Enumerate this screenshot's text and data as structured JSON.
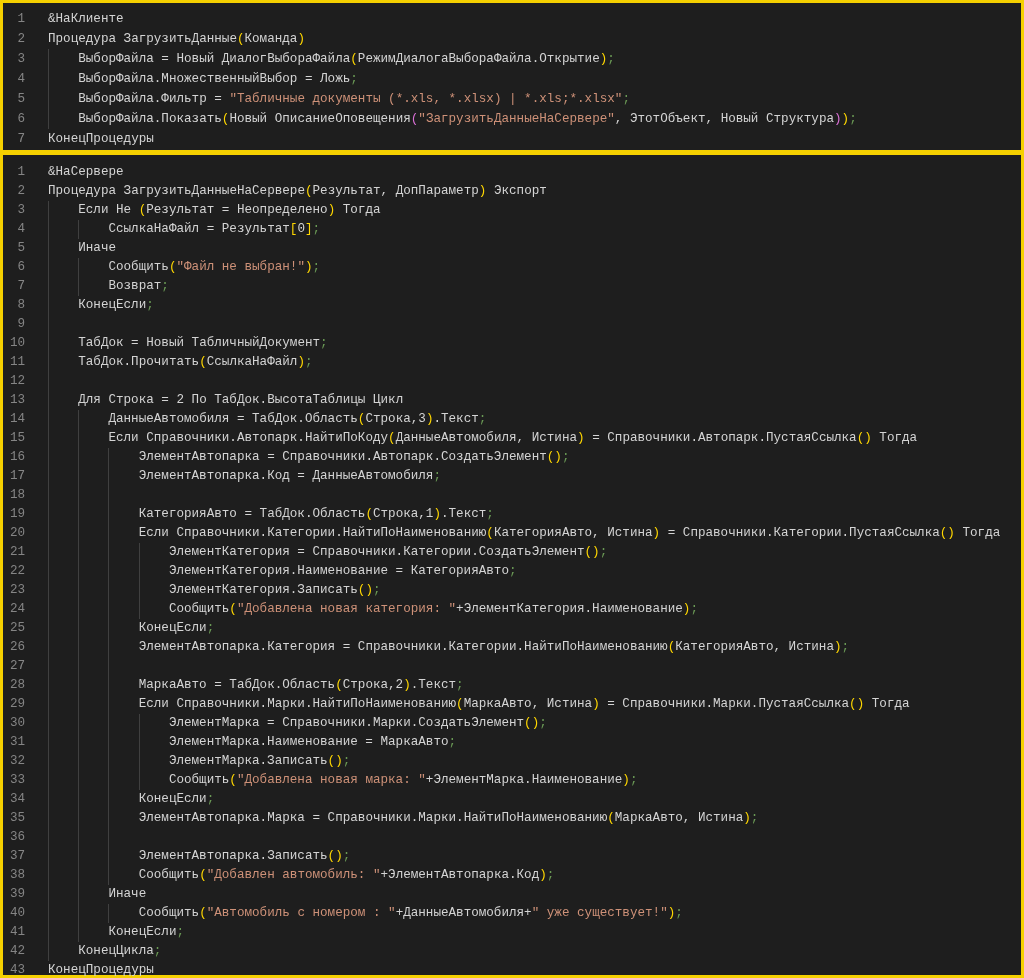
{
  "panels": [
    {
      "lines": [
        {
          "number": "1",
          "code": "&НаКлиенте"
        },
        {
          "number": "2",
          "code": "Процедура ЗагрузитьДанные(Команда)"
        },
        {
          "number": "3",
          "code": "    ВыборФайла = Новый ДиалогВыбораФайла(РежимДиалогаВыбораФайла.Открытие);"
        },
        {
          "number": "4",
          "code": "    ВыборФайла.МножественныйВыбор = Ложь;"
        },
        {
          "number": "5",
          "code": "    ВыборФайла.Фильтр = \"Табличные документы (*.xls, *.xlsx) | *.xls;*.xlsx\";"
        },
        {
          "number": "6",
          "code": "    ВыборФайла.Показать(Новый ОписаниеОповещения(\"ЗагрузитьДанныеНаСервере\", ЭтотОбъект, Новый Структура));"
        },
        {
          "number": "7",
          "code": "КонецПроцедуры"
        }
      ]
    },
    {
      "lines": [
        {
          "number": "1",
          "code": "&НаСервере"
        },
        {
          "number": "2",
          "code": "Процедура ЗагрузитьДанныеНаСервере(Результат, ДопПараметр) Экспорт"
        },
        {
          "number": "3",
          "code": "    Если Не (Результат = Неопределено) Тогда"
        },
        {
          "number": "4",
          "code": "        СсылкаНаФайл = Результат[0];"
        },
        {
          "number": "5",
          "code": "    Иначе"
        },
        {
          "number": "6",
          "code": "        Сообщить(\"Файл не выбран!\");"
        },
        {
          "number": "7",
          "code": "        Возврат;"
        },
        {
          "number": "8",
          "code": "    КонецЕсли;"
        },
        {
          "number": "9"
        },
        {
          "number": "10",
          "code": "    ТабДок = Новый ТабличныйДокумент;"
        },
        {
          "number": "11",
          "code": "    ТабДок.Прочитать(СсылкаНаФайл);"
        },
        {
          "number": "12"
        },
        {
          "number": "13",
          "code": "    Для Строка = 2 По ТабДок.ВысотаТаблицы Цикл"
        },
        {
          "number": "14",
          "code": "        ДанныеАвтомобиля = ТабДок.Область(Строка,3).Текст;"
        },
        {
          "number": "15",
          "code": "        Если Справочники.Автопарк.НайтиПоКоду(ДанныеАвтомобиля, Истина) = Справочники.Автопарк.ПустаяСсылка() Тогда"
        },
        {
          "number": "16",
          "code": "            ЭлементАвтопарка = Справочники.Автопарк.СоздатьЭлемент();"
        },
        {
          "number": "17",
          "code": "            ЭлементАвтопарка.Код = ДанныеАвтомобиля;"
        },
        {
          "number": "18"
        },
        {
          "number": "19",
          "code": "            КатегорияАвто = ТабДок.Область(Строка,1).Текст;"
        },
        {
          "number": "20",
          "code": "            Если Справочники.Категории.НайтиПоНаименованию(КатегорияАвто, Истина) = Справочники.Категории.ПустаяСсылка() Тогда"
        },
        {
          "number": "21",
          "code": "                ЭлементКатегория = Справочники.Категории.СоздатьЭлемент();"
        },
        {
          "number": "22",
          "code": "                ЭлементКатегория.Наименование = КатегорияАвто;"
        },
        {
          "number": "23",
          "code": "                ЭлементКатегория.Записать();"
        },
        {
          "number": "24",
          "code": "                Сообщить(\"Добавлена новая категория: \"+ЭлементКатегория.Наименование);"
        },
        {
          "number": "25",
          "code": "            КонецЕсли;"
        },
        {
          "number": "26",
          "code": "            ЭлементАвтопарка.Категория = Справочники.Категории.НайтиПоНаименованию(КатегорияАвто, Истина);"
        },
        {
          "number": "27"
        },
        {
          "number": "28",
          "code": "            МаркаАвто = ТабДок.Область(Строка,2).Текст;"
        },
        {
          "number": "29",
          "code": "            Если Справочники.Марки.НайтиПоНаименованию(МаркаАвто, Истина) = Справочники.Марки.ПустаяСсылка() Тогда"
        },
        {
          "number": "30",
          "code": "                ЭлементМарка = Справочники.Марки.СоздатьЭлемент();"
        },
        {
          "number": "31",
          "code": "                ЭлементМарка.Наименование = МаркаАвто;"
        },
        {
          "number": "32",
          "code": "                ЭлементМарка.Записать();"
        },
        {
          "number": "33",
          "code": "                Сообщить(\"Добавлена новая марка: \"+ЭлементМарка.Наименование);"
        },
        {
          "number": "34",
          "code": "            КонецЕсли;"
        },
        {
          "number": "35",
          "code": "            ЭлементАвтопарка.Марка = Справочники.Марки.НайтиПоНаименованию(МаркаАвто, Истина);"
        },
        {
          "number": "36"
        },
        {
          "number": "37",
          "code": "            ЭлементАвтопарка.Записать();"
        },
        {
          "number": "38",
          "code": "            Сообщить(\"Добавлен автомобиль: \"+ЭлементАвтопарка.Код);"
        },
        {
          "number": "39",
          "code": "        Иначе"
        },
        {
          "number": "40",
          "code": "            Сообщить(\"Автомобиль с номером : \"+ДанныеАвтомобиля+\" уже существует!\");"
        },
        {
          "number": "41",
          "code": "        КонецЕсли;"
        },
        {
          "number": "42",
          "code": "    КонецЦикла;"
        },
        {
          "number": "43",
          "code": "КонецПроцедуры"
        }
      ]
    }
  ]
}
